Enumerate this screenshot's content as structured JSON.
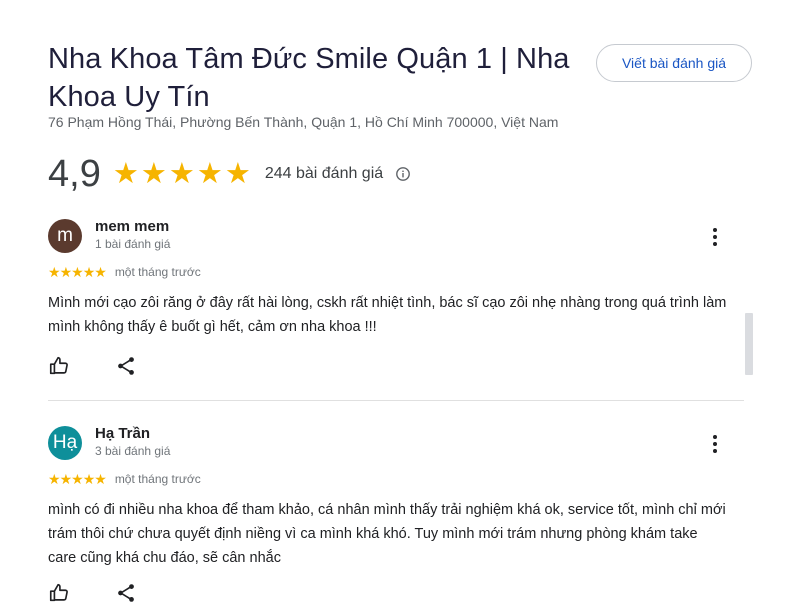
{
  "business": {
    "name": "Nha Khoa Tâm Đức Smile Quận 1 | Nha Khoa Uy Tín",
    "address": "76 Phạm Hồng Thái, Phường Bến Thành, Quận 1, Hồ Chí Minh 700000, Việt Nam",
    "write_review_label": "Viết bài đánh giá",
    "rating": "4,9",
    "stars": 5,
    "review_count_label": "244 bài đánh giá"
  },
  "colors": {
    "star": "#f6b400",
    "link": "#1a56c4",
    "avatar_1": "#5b3a2e",
    "avatar_2": "#0e8f9a"
  },
  "reviews": [
    {
      "initial": "m",
      "author": "mem mem",
      "author_sub": "1 bài đánh giá",
      "stars": 5,
      "time": "một tháng trước",
      "text": "Mình mới cạo zôi răng ở đây rất hài lòng, cskh rất nhiệt tình, bác sĩ cạo zôi nhẹ nhàng trong quá trình làm mình không thấy ê buốt gì hết, cảm ơn nha khoa !!!"
    },
    {
      "initial": "Hạ",
      "author": "Hạ Trần",
      "author_sub": "3 bài đánh giá",
      "stars": 5,
      "time": "một tháng trước",
      "text": "mình có đi nhiều nha khoa để tham khảo, cá nhân mình thấy trải nghiệm khá ok, service tốt, mình chỉ mới trám thôi chứ chưa quyết định niềng vì ca mình khá khó. Tuy mình mới trám nhưng phòng khám take care cũng khá chu đáo, sẽ cân nhắc"
    }
  ]
}
